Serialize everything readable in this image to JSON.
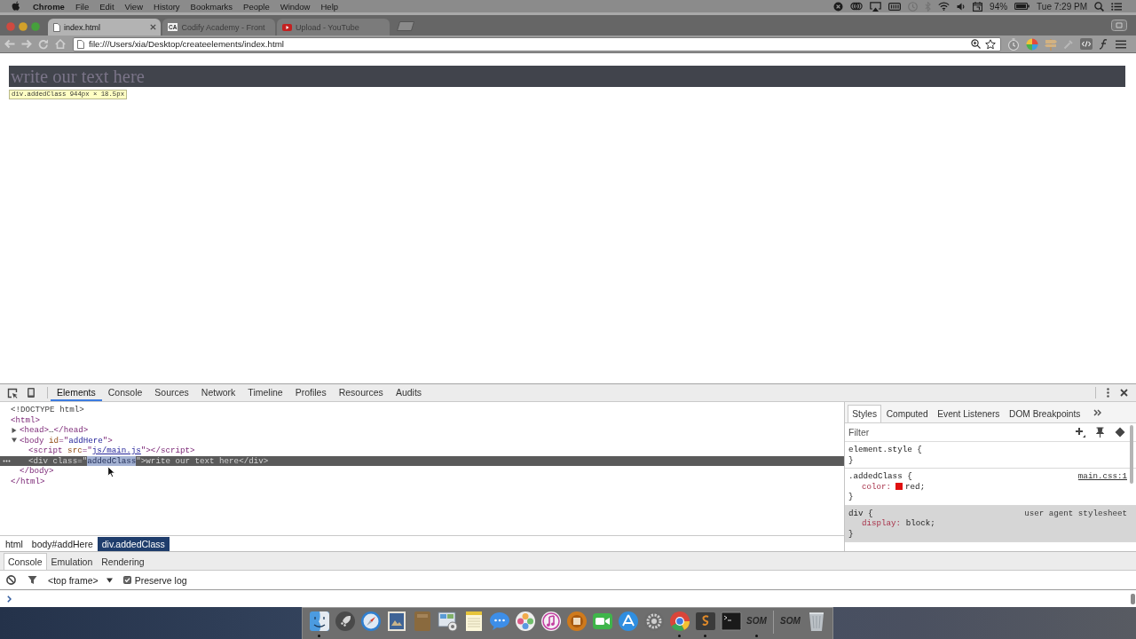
{
  "menu_bar": {
    "app_name": "Chrome",
    "menus": [
      "File",
      "Edit",
      "View",
      "History",
      "Bookmarks",
      "People",
      "Window",
      "Help"
    ],
    "battery": "94%",
    "clock": "Tue 7:29 PM"
  },
  "browser": {
    "tabs": [
      {
        "kind": "page",
        "title": "index.html",
        "selected": true
      },
      {
        "kind": "lettered",
        "favicon_text": "CA",
        "title": "Codify Academy - Front",
        "selected": false
      },
      {
        "kind": "video",
        "title": "Upload - YouTube",
        "selected": false
      }
    ],
    "url": "file:///Users/xia/Desktop/createelements/index.html"
  },
  "page": {
    "highlighted_text": "write our text here",
    "tooltip": {
      "selector": "div.addedClass",
      "size": "944px × 18.5px"
    }
  },
  "devtools": {
    "tabs": [
      {
        "label": "Elements",
        "selected": true
      },
      {
        "label": "Console",
        "selected": false
      },
      {
        "label": "Sources",
        "selected": false
      },
      {
        "label": "Network",
        "selected": false
      },
      {
        "label": "Timeline",
        "selected": false
      },
      {
        "label": "Profiles",
        "selected": false
      },
      {
        "label": "Resources",
        "selected": false
      },
      {
        "label": "Audits",
        "selected": false
      }
    ],
    "dom_tree": [
      {
        "tokens": [
          {
            "kind": "doctype",
            "text": "<!DOCTYPE html>"
          }
        ],
        "selected": false
      },
      {
        "tokens": [
          {
            "kind": "tag",
            "text": "<html>"
          }
        ],
        "selected": false,
        "children": [
          {
            "tokens": [
              {
                "kind": "tag",
                "text": "<head>"
              },
              {
                "kind": "text",
                "text": "…"
              },
              {
                "kind": "tag",
                "text": "</head>"
              }
            ],
            "expanded": false,
            "selected": false
          },
          {
            "tokens": [
              {
                "kind": "tag",
                "text": "<body"
              },
              {
                "kind": "attr",
                "text": " id"
              },
              {
                "kind": "tag",
                "text": "=\""
              },
              {
                "kind": "value",
                "text": "addHere"
              },
              {
                "kind": "tag",
                "text": "\">"
              }
            ],
            "expanded": true,
            "selected": false,
            "children": [
              {
                "tokens": [
                  {
                    "kind": "tag",
                    "text": "<script"
                  },
                  {
                    "kind": "attr",
                    "text": " src"
                  },
                  {
                    "kind": "tag",
                    "text": "=\""
                  },
                  {
                    "kind": "link",
                    "text": "js/main.js"
                  },
                  {
                    "kind": "tag",
                    "text": "\"></script>"
                  }
                ],
                "selected": false
              },
              {
                "tokens": [
                  {
                    "kind": "tag",
                    "text": "<div"
                  },
                  {
                    "kind": "attr",
                    "text": " class"
                  },
                  {
                    "kind": "tag",
                    "text": "=\""
                  },
                  {
                    "kind": "selection",
                    "text": "addedClass"
                  },
                  {
                    "kind": "tag",
                    "text": "\">"
                  },
                  {
                    "kind": "text",
                    "text": "write our text here"
                  },
                  {
                    "kind": "tag",
                    "text": "</div>"
                  }
                ],
                "selected": true
              }
            ],
            "closing": [
              {
                "kind": "tag",
                "text": "</body>"
              }
            ]
          }
        ],
        "closing": [
          {
            "kind": "tag",
            "text": "</html>"
          }
        ]
      }
    ],
    "breadcrumbs": [
      {
        "label": "html",
        "selected": false
      },
      {
        "label": "body#addHere",
        "selected": false
      },
      {
        "label": "div.addedClass",
        "selected": true
      }
    ],
    "styles_pane": {
      "tabs": [
        {
          "label": "Styles",
          "selected": true
        },
        {
          "label": "Computed",
          "selected": false
        },
        {
          "label": "Event Listeners",
          "selected": false
        },
        {
          "label": "DOM Breakpoints",
          "selected": false
        }
      ],
      "filter": {
        "placeholder": "Filter"
      },
      "rules": [
        {
          "kind": "inline",
          "header": "element.style {",
          "footer": "}"
        },
        {
          "kind": "author",
          "header": ".addedClass {",
          "source": "main.css:1",
          "properties": [
            {
              "name": "color:",
              "value": "red;",
              "color": "#e01010"
            }
          ],
          "footer": "}"
        },
        {
          "kind": "user-agent",
          "header": "div {",
          "source": "user agent stylesheet",
          "properties": [
            {
              "name": "display:",
              "value": "block;"
            }
          ],
          "footer": "}"
        }
      ]
    }
  },
  "drawer": {
    "tabs": [
      {
        "label": "Console",
        "selected": true
      },
      {
        "label": "Emulation",
        "selected": false
      },
      {
        "label": "Rendering",
        "selected": false
      }
    ],
    "context": "<top frame>",
    "preserve_log": {
      "label": "Preserve log",
      "checked": true
    }
  },
  "dock": {
    "apps": [
      {
        "kind": "finder",
        "running": true
      },
      {
        "kind": "rocket",
        "running": false
      },
      {
        "kind": "compass",
        "running": false
      },
      {
        "kind": "stamp",
        "running": false
      },
      {
        "kind": "notebook",
        "running": false
      },
      {
        "kind": "photo-stack",
        "running": false
      },
      {
        "kind": "notepad",
        "running": false
      },
      {
        "kind": "bubble",
        "running": false
      },
      {
        "kind": "flower",
        "running": false
      },
      {
        "kind": "note",
        "running": false
      },
      {
        "kind": "disc",
        "running": false
      },
      {
        "kind": "camera",
        "running": false
      },
      {
        "kind": "triangle-disc",
        "running": false
      },
      {
        "kind": "gear",
        "running": false
      },
      {
        "kind": "segmented",
        "running": true
      },
      {
        "kind": "code-tile",
        "running": true
      },
      {
        "kind": "terminal",
        "running": false
      },
      {
        "kind": "label",
        "text": "SOM",
        "running": true
      }
    ],
    "trailing": [
      {
        "kind": "label",
        "text": "SOM",
        "running": false
      },
      {
        "kind": "trash",
        "running": false
      }
    ]
  }
}
